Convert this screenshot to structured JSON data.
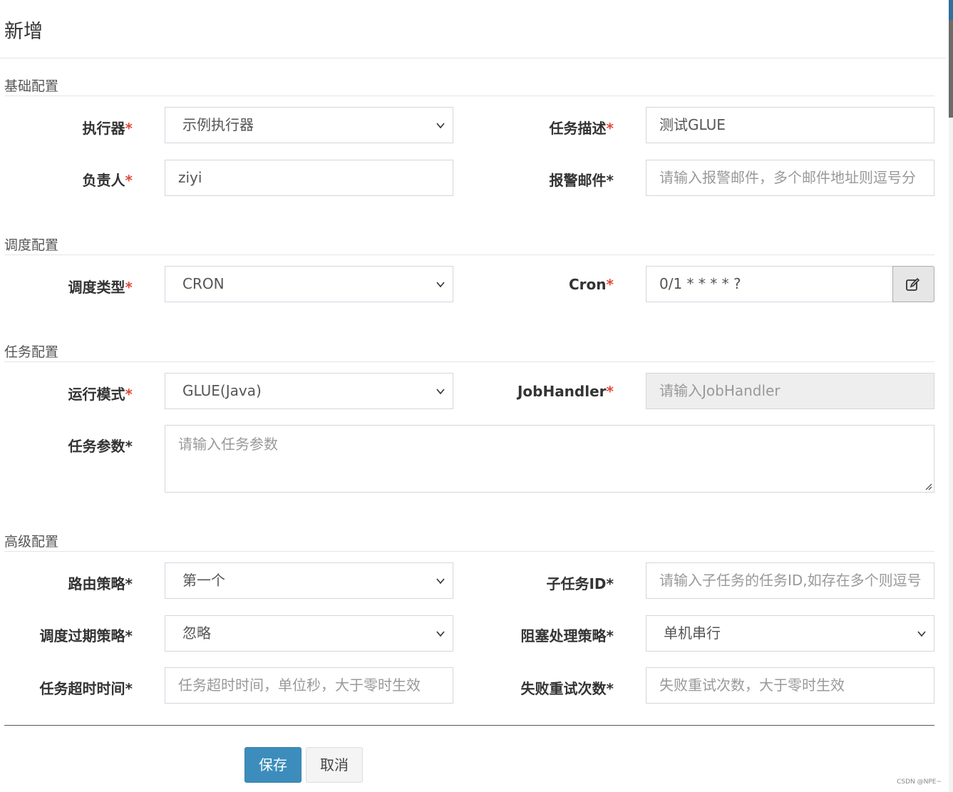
{
  "dialog": {
    "title": "新增"
  },
  "sections": {
    "basic": "基础配置",
    "schedule": "调度配置",
    "task": "任务配置",
    "advanced": "高级配置"
  },
  "fields": {
    "executor": {
      "label": "执行器",
      "value": "示例执行器"
    },
    "task_desc": {
      "label": "任务描述",
      "value": "测试GLUE"
    },
    "owner": {
      "label": "负责人",
      "value": "ziyi"
    },
    "alarm_email": {
      "label": "报警邮件*",
      "placeholder": "请输入报警邮件，多个邮件地址则逗号分"
    },
    "schedule_type": {
      "label": "调度类型",
      "value": "CRON"
    },
    "cron": {
      "label": "Cron",
      "value": "0/1 * * * * ?"
    },
    "run_mode": {
      "label": "运行模式",
      "value": "GLUE(Java)"
    },
    "job_handler": {
      "label": "JobHandler",
      "placeholder": "请输入JobHandler"
    },
    "task_params": {
      "label": "任务参数*",
      "placeholder": "请输入任务参数"
    },
    "route_strategy": {
      "label": "路由策略*",
      "value": "第一个"
    },
    "child_job_id": {
      "label": "子任务ID*",
      "placeholder": "请输入子任务的任务ID,如存在多个则逗号"
    },
    "misfire_strategy": {
      "label": "调度过期策略*",
      "value": "忽略"
    },
    "block_strategy": {
      "label": "阻塞处理策略*",
      "value": "单机串行"
    },
    "timeout": {
      "label": "任务超时时间*",
      "placeholder": "任务超时时间，单位秒，大于零时生效"
    },
    "fail_retry": {
      "label": "失败重试次数*",
      "placeholder": "失败重试次数，大于零时生效"
    }
  },
  "required_mark": "*",
  "buttons": {
    "save": "保存",
    "cancel": "取消"
  },
  "watermark": "CSDN @NPE~",
  "icons": {
    "select": "chevron-down-icon",
    "cron_edit": "edit-icon"
  },
  "colors": {
    "primary": "#3c8dbc",
    "required": "#dd4b39"
  }
}
